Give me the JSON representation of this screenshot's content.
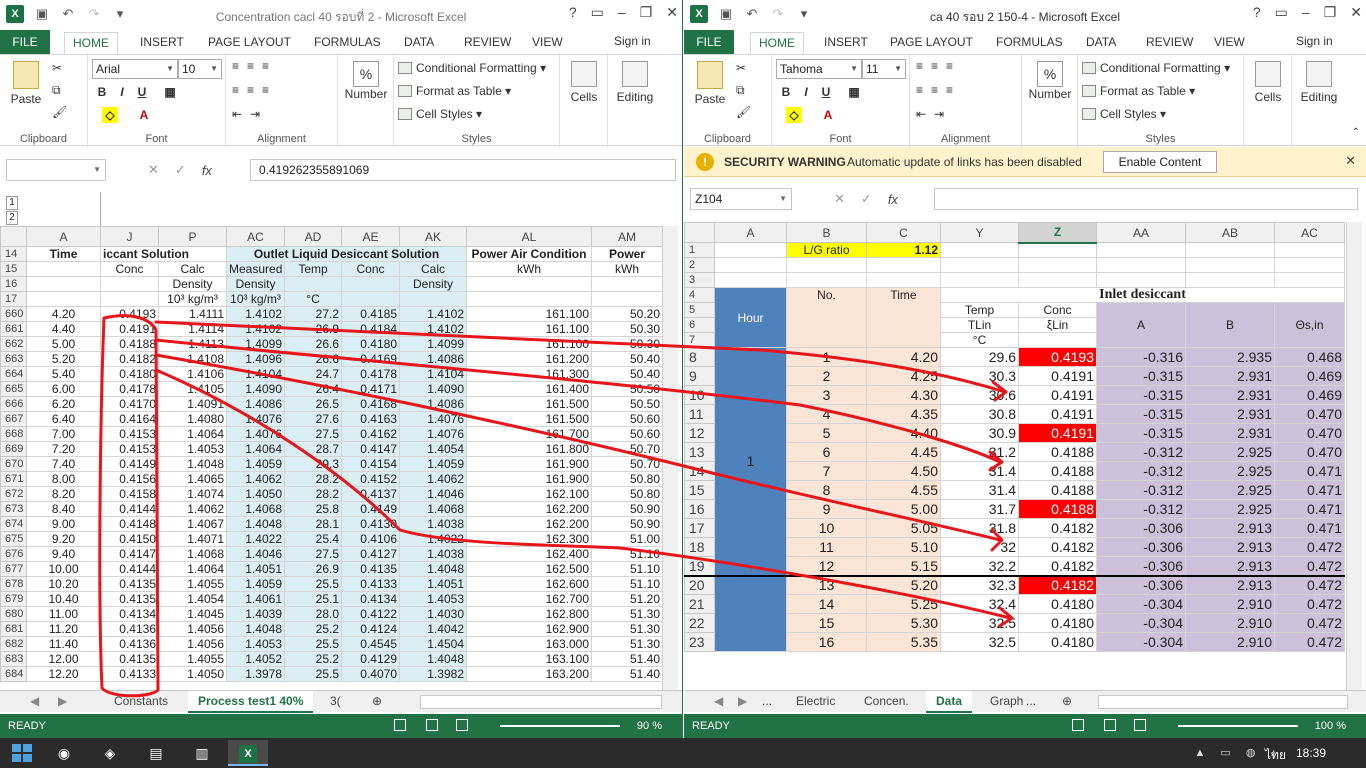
{
  "left": {
    "title": "Concentration cacl 40 รอบที่ 2 - Microsoft Excel",
    "tabs": [
      "FILE",
      "HOME",
      "INSERT",
      "PAGE LAYOUT",
      "FORMULAS",
      "DATA",
      "REVIEW",
      "VIEW"
    ],
    "signin": "Sign in",
    "ribbon": {
      "paste": "Paste",
      "clipboard": "Clipboard",
      "font_name": "Arial",
      "font_size": "10",
      "font_group": "Font",
      "alignment": "Alignment",
      "number": "Number",
      "cond_fmt": "Conditional Formatting",
      "fmt_table": "Format as Table",
      "cell_styles": "Cell Styles",
      "styles": "Styles",
      "cells": "Cells",
      "editing": "Editing"
    },
    "namebox": "",
    "formula": "0.419262355891069",
    "outline": [
      "1",
      "2"
    ],
    "col_headers": [
      "A",
      "J",
      "P",
      "AC",
      "AD",
      "AE",
      "AK",
      "AL",
      "AM"
    ],
    "hdr14": {
      "A": "Time",
      "J": "iccant Solution",
      "AC": "Outlet Liquid Desiccant Solution",
      "AL": "Power Air Condition",
      "AM": "Power"
    },
    "hdr15": {
      "J": "Conc",
      "P": "Calc",
      "AC": "Measured",
      "AD": "Temp",
      "AE": "Conc",
      "AK": "Calc",
      "AL": "kWh",
      "AM": "kWh"
    },
    "hdr16": {
      "P": "Density",
      "AC": "Density",
      "AK": "Density"
    },
    "hdr17": {
      "P": "10³ kg/m³",
      "AC": "10³ kg/m³",
      "AD": "°C"
    },
    "hdr_rows": [
      "14",
      "15",
      "16",
      "17"
    ],
    "rows": [
      [
        "660",
        "4.20",
        "0.4193",
        "1.4111",
        "1.4102",
        "27.2",
        "0.4185",
        "1.4102",
        "161.100",
        "50.20"
      ],
      [
        "661",
        "4.40",
        "0.4191",
        "1.4114",
        "1.4102",
        "26.9",
        "0.4184",
        "1.4102",
        "161.100",
        "50.30"
      ],
      [
        "662",
        "5.00",
        "0.4188",
        "1.4113",
        "1.4099",
        "26.6",
        "0.4180",
        "1.4099",
        "161.100",
        "50.30"
      ],
      [
        "663",
        "5.20",
        "0.4182",
        "1.4108",
        "1.4096",
        "26.6",
        "0.4169",
        "1.4086",
        "161.200",
        "50.40"
      ],
      [
        "664",
        "5.40",
        "0.4180",
        "1.4106",
        "1.4104",
        "24.7",
        "0.4178",
        "1.4104",
        "161.300",
        "50.40"
      ],
      [
        "665",
        "6.00",
        "0.4178",
        "1.4105",
        "1.4090",
        "26.4",
        "0.4171",
        "1.4090",
        "161.400",
        "50.50"
      ],
      [
        "666",
        "6.20",
        "0.4170",
        "1.4091",
        "1.4086",
        "26.5",
        "0.4168",
        "1.4086",
        "161.500",
        "50.50"
      ],
      [
        "667",
        "6.40",
        "0.4164",
        "1.4080",
        "1.4076",
        "27.6",
        "0.4163",
        "1.4076",
        "161.500",
        "50.60"
      ],
      [
        "668",
        "7.00",
        "0.4153",
        "1.4064",
        "1.4076",
        "27.5",
        "0.4162",
        "1.4076",
        "161.700",
        "50.60"
      ],
      [
        "669",
        "7.20",
        "0.4153",
        "1.4053",
        "1.4064",
        "28.7",
        "0.4147",
        "1.4054",
        "161.800",
        "50.70"
      ],
      [
        "670",
        "7.40",
        "0.4149",
        "1.4048",
        "1.4059",
        "29.3",
        "0.4154",
        "1.4059",
        "161.900",
        "50.70"
      ],
      [
        "671",
        "8.00",
        "0.4156",
        "1.4065",
        "1.4062",
        "28.2",
        "0.4152",
        "1.4062",
        "161.900",
        "50.80"
      ],
      [
        "672",
        "8.20",
        "0.4158",
        "1.4074",
        "1.4050",
        "28.2",
        "0.4137",
        "1.4046",
        "162.100",
        "50.80"
      ],
      [
        "673",
        "8.40",
        "0.4144",
        "1.4062",
        "1.4068",
        "25.8",
        "0.4149",
        "1.4068",
        "162.200",
        "50.90"
      ],
      [
        "674",
        "9.00",
        "0.4148",
        "1.4067",
        "1.4048",
        "28.1",
        "0.4130",
        "1.4038",
        "162.200",
        "50.90"
      ],
      [
        "675",
        "9.20",
        "0.4150",
        "1.4071",
        "1.4022",
        "25.4",
        "0.4106",
        "1.4022",
        "162.300",
        "51.00"
      ],
      [
        "676",
        "9.40",
        "0.4147",
        "1.4068",
        "1.4046",
        "27.5",
        "0.4127",
        "1.4038",
        "162.400",
        "51.10"
      ],
      [
        "677",
        "10.00",
        "0.4144",
        "1.4064",
        "1.4051",
        "26.9",
        "0.4135",
        "1.4048",
        "162.500",
        "51.10"
      ],
      [
        "678",
        "10.20",
        "0.4135",
        "1.4055",
        "1.4059",
        "25.5",
        "0.4133",
        "1.4051",
        "162.600",
        "51.10"
      ],
      [
        "679",
        "10.40",
        "0.4135",
        "1.4054",
        "1.4061",
        "25.1",
        "0.4134",
        "1.4053",
        "162.700",
        "51.20"
      ],
      [
        "680",
        "11.00",
        "0.4134",
        "1.4045",
        "1.4039",
        "28.0",
        "0.4122",
        "1.4030",
        "162.800",
        "51.30"
      ],
      [
        "681",
        "11.20",
        "0.4136",
        "1.4056",
        "1.4048",
        "25.2",
        "0.4124",
        "1.4042",
        "162.900",
        "51.30"
      ],
      [
        "682",
        "11.40",
        "0.4136",
        "1.4056",
        "1.4053",
        "25.5",
        "0.4545",
        "1.4504",
        "163.000",
        "51.30"
      ],
      [
        "683",
        "12.00",
        "0.4135",
        "1.4055",
        "1.4052",
        "25.2",
        "0.4129",
        "1.4048",
        "163.100",
        "51.40"
      ],
      [
        "684",
        "12.20",
        "0.4133",
        "1.4050",
        "1.3978",
        "25.5",
        "0.4070",
        "1.3982",
        "163.200",
        "51.40"
      ]
    ],
    "sheet_tabs": [
      "Constants",
      "Process test1 40%",
      "3("
    ],
    "status": "READY",
    "zoom": "90 %"
  },
  "right": {
    "title": "ca 40 รอบ 2 150-4 - Microsoft Excel",
    "tabs": [
      "FILE",
      "HOME",
      "INSERT",
      "PAGE LAYOUT",
      "FORMULAS",
      "DATA",
      "REVIEW",
      "VIEW"
    ],
    "signin": "Sign in",
    "ribbon": {
      "paste": "Paste",
      "clipboard": "Clipboard",
      "font_name": "Tahoma",
      "font_size": "11",
      "font_group": "Font",
      "alignment": "Alignment",
      "number": "Number",
      "cond_fmt": "Conditional Formatting",
      "fmt_table": "Format as Table",
      "cell_styles": "Cell Styles",
      "styles": "Styles",
      "cells": "Cells",
      "editing": "Editing"
    },
    "security": {
      "title": "SECURITY WARNING",
      "msg": "Automatic update of links has been disabled",
      "button": "Enable Content"
    },
    "namebox": "Z104",
    "formula": "",
    "col_headers": [
      "A",
      "B",
      "C",
      "Y",
      "Z",
      "AA",
      "AB",
      "AC"
    ],
    "lg_label": "L/G ratio",
    "lg_value": "1.12",
    "hdr": {
      "no": "No.",
      "time": "Time",
      "hour": "Hour",
      "inlet": "Inlet desiccant",
      "temp": "Temp",
      "conc": "Conc",
      "tlin": "TLin",
      "xlin": "ξLin",
      "degc": "°C",
      "A": "A",
      "B": "B",
      "theta": "Θs,in"
    },
    "small_rows": [
      "1",
      "2",
      "3",
      "4",
      "5",
      "6",
      "7"
    ],
    "group_label": "1",
    "rows": [
      [
        "8",
        "1",
        "4.20",
        "29.6",
        "0.4193",
        "-0.316",
        "2.935",
        "0.468",
        true
      ],
      [
        "9",
        "2",
        "4.25",
        "30.3",
        "0.4191",
        "-0.315",
        "2.931",
        "0.469",
        false
      ],
      [
        "10",
        "3",
        "4.30",
        "30.6",
        "0.4191",
        "-0.315",
        "2.931",
        "0.469",
        false
      ],
      [
        "11",
        "4",
        "4.35",
        "30.8",
        "0.4191",
        "-0.315",
        "2.931",
        "0.470",
        false
      ],
      [
        "12",
        "5",
        "4.40",
        "30.9",
        "0.4191",
        "-0.315",
        "2.931",
        "0.470",
        true
      ],
      [
        "13",
        "6",
        "4.45",
        "31.2",
        "0.4188",
        "-0.312",
        "2.925",
        "0.470",
        false
      ],
      [
        "14",
        "7",
        "4.50",
        "31.4",
        "0.4188",
        "-0.312",
        "2.925",
        "0.471",
        false
      ],
      [
        "15",
        "8",
        "4.55",
        "31.4",
        "0.4188",
        "-0.312",
        "2.925",
        "0.471",
        false
      ],
      [
        "16",
        "9",
        "5.00",
        "31.7",
        "0.4188",
        "-0.312",
        "2.925",
        "0.471",
        true
      ],
      [
        "17",
        "10",
        "5.05",
        "31.8",
        "0.4182",
        "-0.306",
        "2.913",
        "0.471",
        false
      ],
      [
        "18",
        "11",
        "5.10",
        "32",
        "0.4182",
        "-0.306",
        "2.913",
        "0.472",
        false
      ],
      [
        "19",
        "12",
        "5.15",
        "32.2",
        "0.4182",
        "-0.306",
        "2.913",
        "0.472",
        false
      ],
      [
        "20",
        "13",
        "5.20",
        "32.3",
        "0.4182",
        "-0.306",
        "2.913",
        "0.472",
        true
      ],
      [
        "21",
        "14",
        "5.25",
        "32.4",
        "0.4180",
        "-0.304",
        "2.910",
        "0.472",
        false
      ],
      [
        "22",
        "15",
        "5.30",
        "32.5",
        "0.4180",
        "-0.304",
        "2.910",
        "0.472",
        false
      ],
      [
        "23",
        "16",
        "5.35",
        "32.5",
        "0.4180",
        "-0.304",
        "2.910",
        "0.472",
        false
      ]
    ],
    "sheet_tabs": [
      "...",
      "Electric",
      "Concen.",
      "Data",
      "Graph",
      "..."
    ],
    "status": "READY",
    "zoom": "100 %"
  },
  "taskbar": {
    "time": "18:39",
    "lang": "ไทย"
  },
  "colors": {
    "excel_green": "#217346",
    "outlet_blue": "#daeef3",
    "warning": "#fff2cc",
    "highlight_red": "#ff0000",
    "annotation": "#e8161b"
  }
}
